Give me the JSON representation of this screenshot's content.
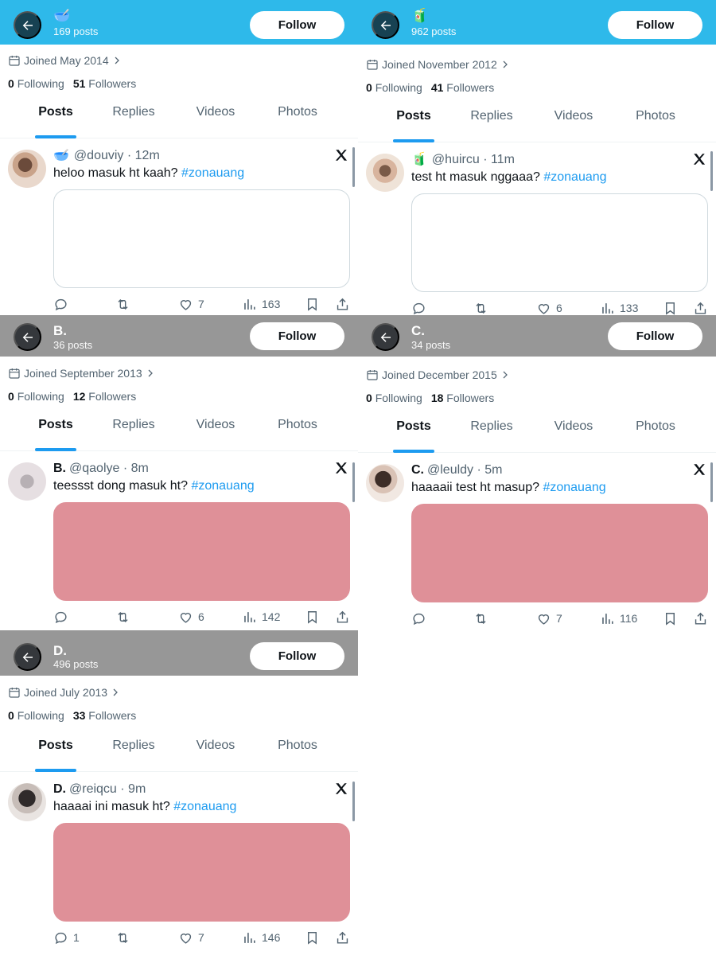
{
  "panels": [
    {
      "bar_color": "#2eb9ea",
      "title": "🥣",
      "posts_count": "169 posts",
      "follow_label": "Follow",
      "joined": "Joined May 2014",
      "following_count": "0",
      "following_label": "Following",
      "followers_count": "51",
      "followers_label": "Followers",
      "tabs": [
        "Posts",
        "Replies",
        "Videos",
        "Photos"
      ],
      "tweet": {
        "name": "",
        "emoji": "🥣",
        "handle": "@douviy",
        "time": "· 12m",
        "text": "heloo masuk ht kaah?",
        "hashtag": "#zonauang",
        "media_color": "#ffffff",
        "replies": "",
        "likes": "7",
        "views": "163"
      }
    },
    {
      "bar_color": "#2eb9ea",
      "title": "🧃",
      "posts_count": "962 posts",
      "follow_label": "Follow",
      "joined": "Joined November 2012",
      "following_count": "0",
      "following_label": "Following",
      "followers_count": "41",
      "followers_label": "Followers",
      "tabs": [
        "Posts",
        "Replies",
        "Videos",
        "Photos"
      ],
      "tweet": {
        "name": "",
        "emoji": "🧃",
        "handle": "@huircu",
        "time": "· 11m",
        "text": "test ht masuk nggaaa?",
        "hashtag": "#zonauang",
        "media_color": "#ffffff",
        "replies": "",
        "likes": "6",
        "views": "133"
      }
    },
    {
      "bar_color": "#979797",
      "title": "B.",
      "posts_count": "36 posts",
      "follow_label": "Follow",
      "joined": "Joined September 2013",
      "following_count": "0",
      "following_label": "Following",
      "followers_count": "12",
      "followers_label": "Followers",
      "tabs": [
        "Posts",
        "Replies",
        "Videos",
        "Photos"
      ],
      "tweet": {
        "name": "B.",
        "emoji": "",
        "handle": "@qaolye",
        "time": "· 8m",
        "text": "teessst dong masuk ht?",
        "hashtag": "#zonauang",
        "media_color": "#df9098",
        "replies": "",
        "likes": "6",
        "views": "142"
      }
    },
    {
      "bar_color": "#979797",
      "title": "C.",
      "posts_count": "34 posts",
      "follow_label": "Follow",
      "joined": "Joined December 2015",
      "following_count": "0",
      "following_label": "Following",
      "followers_count": "18",
      "followers_label": "Followers",
      "tabs": [
        "Posts",
        "Replies",
        "Videos",
        "Photos"
      ],
      "tweet": {
        "name": "C.",
        "emoji": "",
        "handle": "@leuldy",
        "time": "· 5m",
        "text": "haaaaii test ht masup?",
        "hashtag": "#zonauang",
        "media_color": "#df9098",
        "replies": "",
        "likes": "7",
        "views": "116"
      }
    },
    {
      "bar_color": "#979797",
      "title": "D.",
      "posts_count": "496 posts",
      "follow_label": "Follow",
      "joined": "Joined July 2013",
      "following_count": "0",
      "following_label": "Following",
      "followers_count": "33",
      "followers_label": "Followers",
      "tabs": [
        "Posts",
        "Replies",
        "Videos",
        "Photos"
      ],
      "tweet": {
        "name": "D.",
        "emoji": "",
        "handle": "@reiqcu",
        "time": "· 9m",
        "text": "haaaai ini masuk ht?",
        "hashtag": "#zonauang",
        "media_color": "#df9098",
        "replies": "1",
        "likes": "7",
        "views": "146"
      }
    }
  ]
}
